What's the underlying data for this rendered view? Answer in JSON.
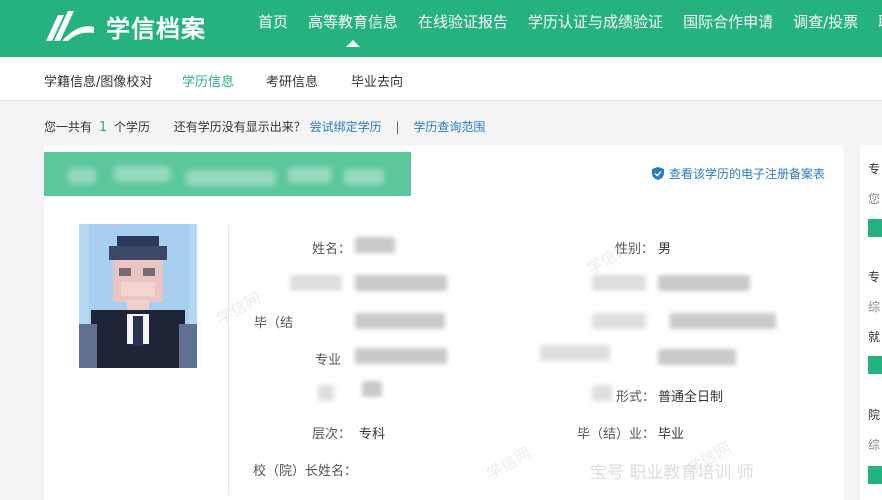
{
  "header": {
    "logo_text": "学信档案",
    "nav": [
      "首页",
      "高等教育信息",
      "在线验证报告",
      "学历认证与成绩验证",
      "国际合作申请",
      "调查/投票",
      "职"
    ]
  },
  "subnav": {
    "items": [
      "学籍信息/图像校对",
      "学历信息",
      "考研信息",
      "毕业去向"
    ],
    "active": "学历信息"
  },
  "info": {
    "prefix": "您一共有",
    "count": "1",
    "suffix": "个学历",
    "question": "还有学历没有显示出来？",
    "bind_link": "尝试绑定学历",
    "separator": "|",
    "scope_link": "学历查询范围"
  },
  "card": {
    "record_link": "查看该学历的电子注册备案表",
    "fields": {
      "name_label": "姓名：",
      "gender_label": "性别：",
      "gender_value": "男",
      "grad_label_partial": "毕（结",
      "major_label": "专业",
      "study_form_label_partial": "形式：",
      "study_form_value": "普通全日制",
      "level_label": "层次：",
      "level_value": "专科",
      "grad_label": "毕（结）业：",
      "grad_value": "毕业",
      "president_label": "校（院）长姓名："
    }
  },
  "sidebar": {
    "items": [
      "专",
      "您",
      "专",
      "综",
      "就",
      "院",
      "综"
    ]
  },
  "watermarks": [
    "学信网",
    "学信网",
    "学信网",
    "学信网"
  ],
  "footer_overlay": "宝号 职业教育培训 师",
  "colors": {
    "brand": "#24b37f",
    "link": "#2a7bc4"
  }
}
